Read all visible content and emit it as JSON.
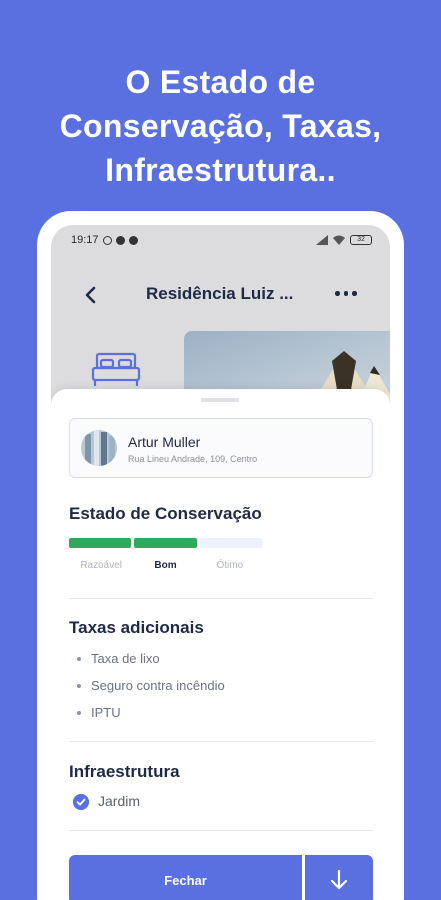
{
  "headline": {
    "line1": "O Estado de",
    "line2": "Conservação, Taxas,",
    "line3": "Infraestrutura.."
  },
  "status_bar": {
    "time": "19:17",
    "battery": "32"
  },
  "app_bar": {
    "title": "Residência Luiz ..."
  },
  "owner": {
    "name": "Artur Muller",
    "address": "Rua Lineu Andrade, 109, Centro"
  },
  "conservation": {
    "title": "Estado de Conservação",
    "levels": [
      "Razoável",
      "Bom",
      "Ótimo"
    ],
    "selected_level": "Bom",
    "filled_segments": 2,
    "total_segments": 3
  },
  "fees": {
    "title": "Taxas adicionais",
    "items": [
      "Taxa de lixo",
      "Seguro contra incêndio",
      "IPTU"
    ]
  },
  "infrastructure": {
    "title": "Infraestrutura",
    "items": [
      "Jardim"
    ]
  },
  "actions": {
    "close_label": "Fechar"
  },
  "colors": {
    "primary": "#5a6fe0",
    "bar_filled": "#2eaa5c",
    "bar_empty": "#eef0fa",
    "text_dark": "#1f2a44"
  }
}
